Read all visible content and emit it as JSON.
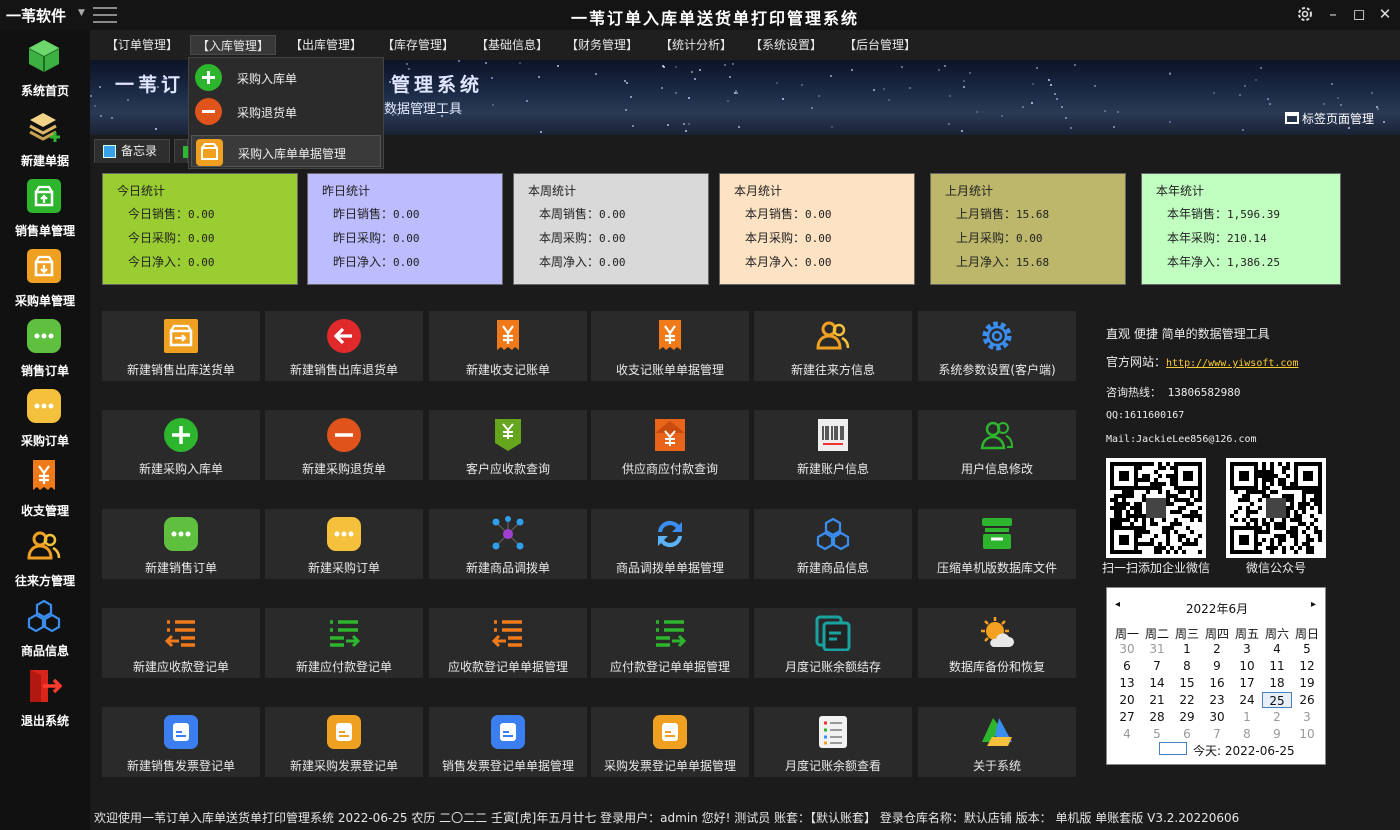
{
  "app": {
    "name": "一苇软件",
    "title": "一苇订单入库单送货单打印管理系统"
  },
  "sidebar": {
    "items": [
      {
        "label": "系统首页",
        "icon": "green-cube-icon"
      },
      {
        "label": "新建单据",
        "icon": "layers-add-icon"
      },
      {
        "label": "销售单管理",
        "icon": "green-box-icon"
      },
      {
        "label": "采购单管理",
        "icon": "orange-box-icon"
      },
      {
        "label": "销售订单",
        "icon": "green-chat-icon"
      },
      {
        "label": "采购订单",
        "icon": "yellow-chat-icon"
      },
      {
        "label": "收支管理",
        "icon": "yen-receipt-icon"
      },
      {
        "label": "往来方管理",
        "icon": "contacts-icon"
      },
      {
        "label": "商品信息",
        "icon": "blue-cubes-icon"
      },
      {
        "label": "退出系统",
        "icon": "exit-icon"
      }
    ]
  },
  "menu": {
    "items": [
      "【订单管理】",
      "【入库管理】",
      "【出库管理】",
      "【库存管理】",
      "【基础信息】",
      "【财务管理】",
      "【统计分析】",
      "【系统设置】",
      "【后台管理】"
    ],
    "active": "【入库管理】"
  },
  "banner": {
    "title": "一苇订",
    "title_tail": "管理系统",
    "subtitle": "数据管理工具",
    "tag_page": "标签页面管理"
  },
  "dropdown": {
    "items": [
      "采购入库单",
      "采购退货单",
      "采购入库单单据管理"
    ]
  },
  "tabs": {
    "memo": "备忘录"
  },
  "stats": [
    {
      "title": "今日统计",
      "rows": [
        [
          "今日销售：",
          "0.00"
        ],
        [
          "今日采购：",
          "0.00"
        ],
        [
          "今日净入：",
          "0.00"
        ]
      ],
      "color": "#9acd32"
    },
    {
      "title": "昨日统计",
      "rows": [
        [
          "昨日销售：",
          "0.00"
        ],
        [
          "昨日采购：",
          "0.00"
        ],
        [
          "昨日净入：",
          "0.00"
        ]
      ],
      "color": "#bcbcff"
    },
    {
      "title": "本周统计",
      "rows": [
        [
          "本周销售：",
          "0.00"
        ],
        [
          "本周采购：",
          "0.00"
        ],
        [
          "本周净入：",
          "0.00"
        ]
      ],
      "color": "#d9d9d9"
    },
    {
      "title": "本月统计",
      "rows": [
        [
          "本月销售：",
          "0.00"
        ],
        [
          "本月采购：",
          "0.00"
        ],
        [
          "本月净入：",
          "0.00"
        ]
      ],
      "color": "#fde3c4"
    },
    {
      "title": "上月统计",
      "rows": [
        [
          "上月销售：",
          "15.68"
        ],
        [
          "上月采购：",
          "0.00"
        ],
        [
          "上月净入：",
          "15.68"
        ]
      ],
      "color": "#bdb76b"
    },
    {
      "title": "本年统计",
      "rows": [
        [
          "本年销售：",
          "1,596.39"
        ],
        [
          "本年采购：",
          "210.14"
        ],
        [
          "本年净入：",
          "1,386.25"
        ]
      ],
      "color": "#c1ffc1"
    }
  ],
  "tiles": [
    [
      "新建销售出库送货单",
      "新建销售出库退货单",
      "新建收支记账单",
      "收支记账单单据管理",
      "新建往来方信息",
      "系统参数设置(客户端)"
    ],
    [
      "新建采购入库单",
      "新建采购退货单",
      "客户应收款查询",
      "供应商应付款查询",
      "新建账户信息",
      "用户信息修改"
    ],
    [
      "新建销售订单",
      "新建采购订单",
      "新建商品调拨单",
      "商品调拨单单据管理",
      "新建商品信息",
      "压缩单机版数据库文件"
    ],
    [
      "新建应收款登记单",
      "新建应付款登记单",
      "应收款登记单单据管理",
      "应付款登记单单据管理",
      "月度记账余额结存",
      "数据库备份和恢复"
    ],
    [
      "新建销售发票登记单",
      "新建采购发票登记单",
      "销售发票登记单单据管理",
      "采购发票登记单单据管理",
      "月度记账余额查看",
      "关于系统"
    ]
  ],
  "tile_icons": [
    [
      "orange-box-out-icon",
      "red-back-arrow-icon",
      "yen-receipt-icon",
      "yen-receipt-icon",
      "contacts-icon",
      "gear-icon"
    ],
    [
      "green-plus-icon",
      "red-minus-icon",
      "receivable-icon",
      "payable-icon",
      "barcode-icon",
      "users-icon"
    ],
    [
      "green-chat-icon",
      "yellow-chat-icon",
      "transfer-icon",
      "refresh-icon",
      "blue-cubes-icon",
      "archive-icon"
    ],
    [
      "orange-list-in-icon",
      "green-list-out-icon",
      "orange-list-in-icon",
      "green-list-out-icon",
      "ledger-icon",
      "weather-icon"
    ],
    [
      "blue-invoice-icon",
      "orange-invoice-icon",
      "blue-invoice-icon",
      "orange-invoice-icon",
      "checklist-icon",
      "about-icon"
    ]
  ],
  "info": {
    "slogan": "直观 便捷 简单的数据管理工具",
    "website_label": "官方网站：",
    "website": "http://www.yiwsoft.com",
    "hotline": "咨询热线： 13806582980",
    "qq": "QQ:1611600167",
    "mail": "Mail:JackieLee856@126.com",
    "qr1_caption": "扫一扫添加企业微信",
    "qr2_caption": "微信公众号"
  },
  "calendar": {
    "title": "2022年6月",
    "prev": "◂",
    "next": "▸",
    "weekdays": [
      "周一",
      "周二",
      "周三",
      "周四",
      "周五",
      "周六",
      "周日"
    ],
    "weeks": [
      [
        "30",
        "31",
        "1",
        "2",
        "3",
        "4",
        "5"
      ],
      [
        "6",
        "7",
        "8",
        "9",
        "10",
        "11",
        "12"
      ],
      [
        "13",
        "14",
        "15",
        "16",
        "17",
        "18",
        "19"
      ],
      [
        "20",
        "21",
        "22",
        "23",
        "24",
        "25",
        "26"
      ],
      [
        "27",
        "28",
        "29",
        "30",
        "1",
        "2",
        "3"
      ],
      [
        "4",
        "5",
        "6",
        "7",
        "8",
        "9",
        "10"
      ]
    ],
    "today_label": "今天: 2022-06-25"
  },
  "status": "欢迎使用一苇订单入库单送货单打印管理系统 2022-06-25 农历 二〇二二 壬寅[虎]年五月廿七 登录用户：admin 您好! 测试员 账套：【默认账套】 登录仓库名称：默认店铺 版本：  单机版 单账套版 V3.2.20220606"
}
